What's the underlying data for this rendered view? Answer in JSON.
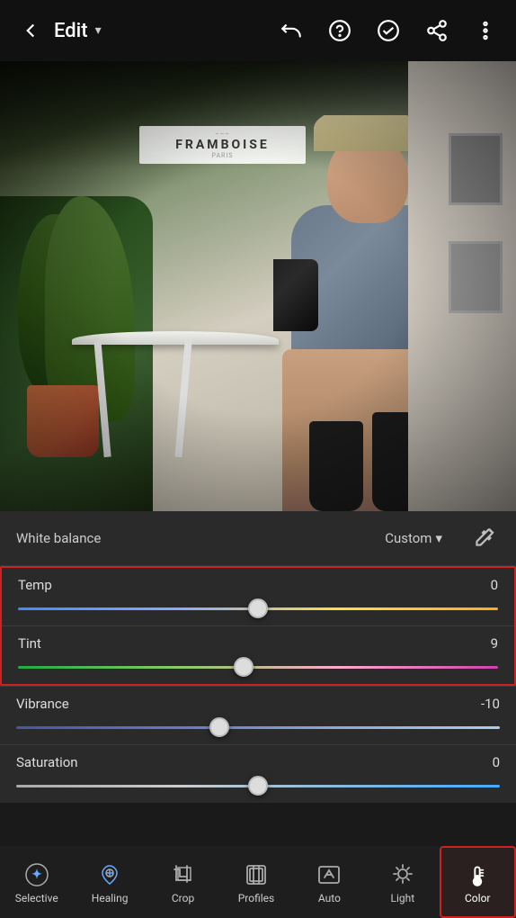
{
  "header": {
    "back_label": "←",
    "title": "Edit",
    "dropdown_arrow": "▾",
    "undo_icon": "undo",
    "help_icon": "help",
    "check_icon": "check",
    "share_icon": "share",
    "more_icon": "more"
  },
  "photo": {
    "sign_text": "FRAMBOISE"
  },
  "white_balance": {
    "label": "White balance",
    "value_label": "Custom",
    "dropdown_arrow": "▾",
    "edit_icon": "eyedropper"
  },
  "sliders": [
    {
      "label": "Temp",
      "value": "0",
      "thumb_pct": 50,
      "track_type": "temp"
    },
    {
      "label": "Tint",
      "value": "9",
      "thumb_pct": 46,
      "track_type": "tint"
    },
    {
      "label": "Vibrance",
      "value": "-10",
      "thumb_pct": 42,
      "track_type": "vibrance"
    },
    {
      "label": "Saturation",
      "value": "0",
      "thumb_pct": 50,
      "track_type": "saturation"
    }
  ],
  "bottom_tabs": [
    {
      "id": "selective",
      "label": "Selective",
      "icon": "selective",
      "active": false
    },
    {
      "id": "healing",
      "label": "Healing",
      "icon": "healing",
      "active": false
    },
    {
      "id": "crop",
      "label": "Crop",
      "icon": "crop",
      "active": false
    },
    {
      "id": "profiles",
      "label": "Profiles",
      "icon": "profiles",
      "active": false
    },
    {
      "id": "auto",
      "label": "Auto",
      "icon": "auto",
      "active": false
    },
    {
      "id": "light",
      "label": "Light",
      "icon": "light",
      "active": false
    },
    {
      "id": "color",
      "label": "Color",
      "icon": "thermometer",
      "active": true
    }
  ],
  "colors": {
    "accent_red": "#cc2222",
    "background_dark": "#1a1a1a",
    "panel_bg": "#2a2a2a",
    "text_primary": "#ffffff",
    "text_secondary": "#cccccc"
  }
}
